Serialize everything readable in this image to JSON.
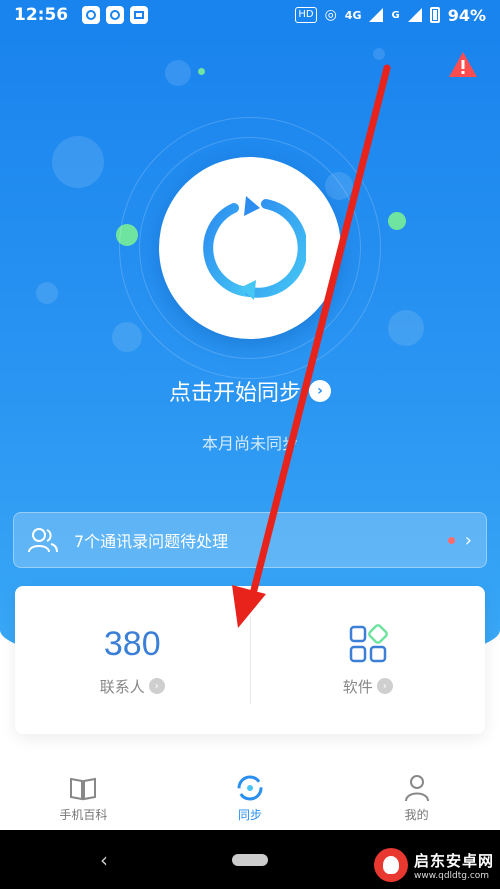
{
  "status_bar": {
    "time": "12:56",
    "hd_label": "HD",
    "network_label": "4G",
    "network_label_2": "G",
    "battery": "94%"
  },
  "hero": {
    "sync_title": "点击开始同步",
    "sync_subtitle": "本月尚未同步"
  },
  "notice": {
    "text": "7个通讯录问题待处理"
  },
  "stats": {
    "contacts_value": "380",
    "contacts_label": "联系人",
    "apps_label": "软件"
  },
  "bottom_nav": {
    "items": [
      {
        "label": "手机百科",
        "icon": "book-icon"
      },
      {
        "label": "同步",
        "icon": "sync-icon",
        "active": true
      },
      {
        "label": "我的",
        "icon": "person-icon"
      }
    ]
  },
  "watermark": {
    "name": "启东安卓网",
    "url": "www.qdldtg.com"
  },
  "colors": {
    "primary": "#1a84ee",
    "accent_green": "#6fe3a0",
    "arrow_red": "#e8231c",
    "stat_blue": "#3b7fd6"
  }
}
